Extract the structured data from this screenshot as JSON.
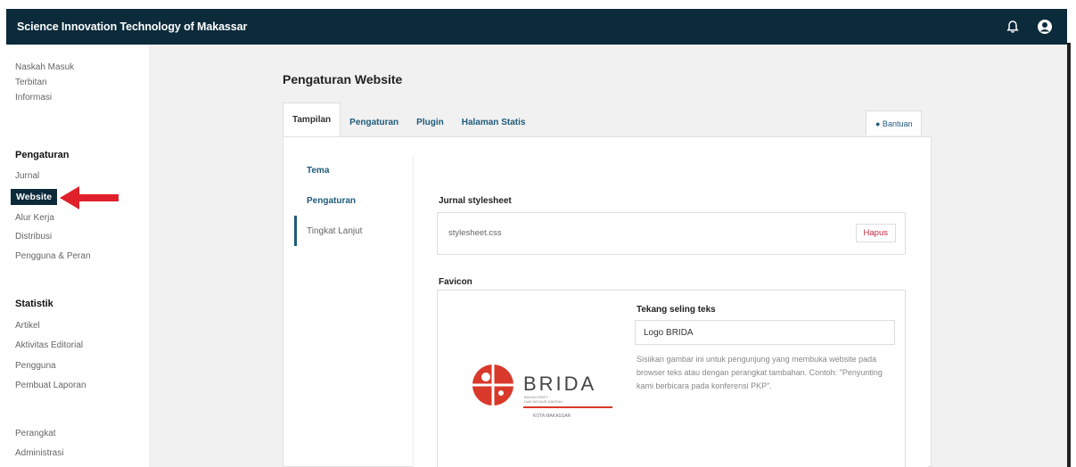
{
  "header": {
    "title": "Science Innovation Technology of Makassar"
  },
  "sidebar": {
    "top_items": [
      {
        "label": "Naskah Masuk"
      },
      {
        "label": "Terbitan"
      },
      {
        "label": "Informasi"
      }
    ],
    "settings_heading": "Pengaturan",
    "settings_items": [
      {
        "label": "Jurnal"
      },
      {
        "label": "Website"
      },
      {
        "label": "Alur Kerja"
      },
      {
        "label": "Distribusi"
      },
      {
        "label": "Pengguna & Peran"
      }
    ],
    "stats_heading": "Statistik",
    "stats_items": [
      {
        "label": "Artikel"
      },
      {
        "label": "Aktivitas Editorial"
      },
      {
        "label": "Pengguna"
      },
      {
        "label": "Pembuat Laporan"
      }
    ],
    "tools_items": [
      {
        "label": "Perangkat"
      },
      {
        "label": "Administrasi"
      }
    ]
  },
  "main": {
    "page_title": "Pengaturan Website",
    "tabs": [
      {
        "label": "Tampilan"
      },
      {
        "label": "Pengaturan"
      },
      {
        "label": "Plugin"
      },
      {
        "label": "Halaman Statis"
      }
    ],
    "help_label": "● Bantuan",
    "subnav": [
      {
        "label": "Tema"
      },
      {
        "label": "Pengaturan"
      },
      {
        "label": "Tingkat Lanjut"
      }
    ],
    "stylesheet": {
      "label": "Jurnal stylesheet",
      "file": "stylesheet.css",
      "delete_label": "Hapus"
    },
    "favicon": {
      "label": "Favicon",
      "logo_text": "BRIDA",
      "logo_small1": "BADAN RISET",
      "logo_small2": "DAN INOVASI DAERAH",
      "logo_city": "KOTA MAKASSAR",
      "alt_label": "Tekang seling teks",
      "alt_value": "Logo BRIDA",
      "alt_help": "Sisiikan gambar ini untuk pengunjung yang membuka website pada browser teks atau dengan perangkat tambahan. Contoh: \"Penyunting kami berbicara pada konferensi PKP\"."
    }
  },
  "colors": {
    "topbar": "#0b2a3a",
    "accent_link": "#1f5b7a",
    "danger": "#c0263d",
    "annotation_arrow": "#e0202a",
    "logo_red": "#d8392b"
  }
}
